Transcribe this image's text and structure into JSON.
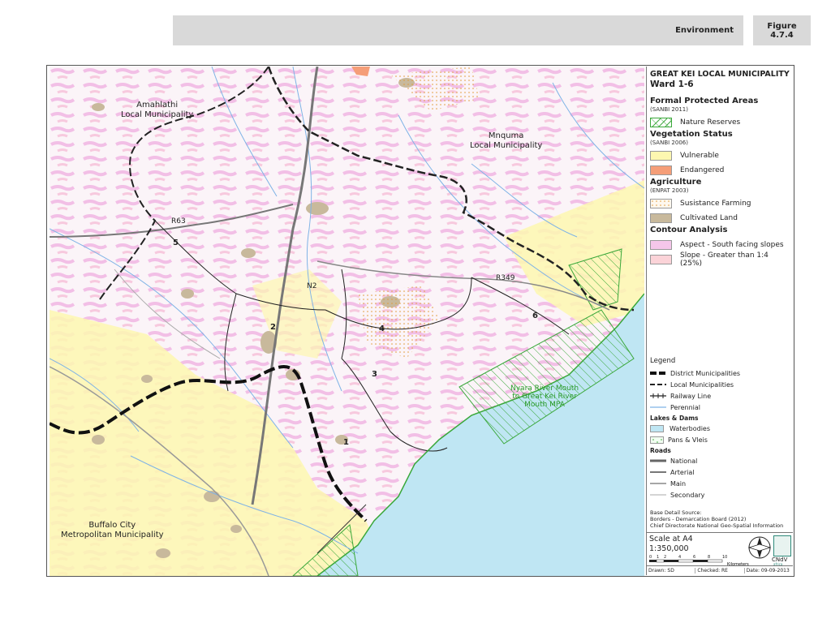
{
  "header": {
    "title": "Environment",
    "figure_label": "Figure",
    "figure_number": "4.7.4"
  },
  "legend": {
    "title": "GREAT KEI LOCAL MUNICIPALITY",
    "subtitle": "Ward 1-6",
    "sections": [
      {
        "title": "Formal Protected Areas",
        "source": "(SANBI 2011)",
        "items": [
          {
            "label": "Nature Reserves",
            "swatch": "hatch-green"
          }
        ]
      },
      {
        "title": "Vegetation Status",
        "source": "(SANBI 2006)",
        "items": [
          {
            "label": "Vulnerable",
            "color": "#fdf7b0"
          },
          {
            "label": "Endangered",
            "color": "#f59e78"
          }
        ]
      },
      {
        "title": "Agriculture",
        "source": "(ENPAT 2003)",
        "items": [
          {
            "label": "Susistance Farming",
            "swatch": "dots-orange"
          },
          {
            "label": "Cultivated Land",
            "color": "#c8b99c"
          }
        ]
      },
      {
        "title": "Contour Analysis",
        "source": "",
        "items": [
          {
            "label": "Aspect - South facing slopes",
            "color": "#f5c6ea"
          },
          {
            "label": "Slope - Greater than 1:4 (25%)",
            "color": "#fbd3d8"
          }
        ]
      }
    ],
    "lines_heading": "Legend",
    "lines": [
      {
        "label": "District Municipalities",
        "style": "district"
      },
      {
        "label": "Local Municipalities",
        "style": "local"
      },
      {
        "label": "Railway Line",
        "style": "rail"
      },
      {
        "label": "Perennial",
        "style": "river"
      }
    ],
    "lakes_heading": "Lakes & Dams",
    "lakes": [
      {
        "label": "Waterbodies",
        "color": "#bfe6f3"
      },
      {
        "label": "Pans & Vleis",
        "swatch": "dots-green"
      }
    ],
    "roads_heading": "Roads",
    "roads": [
      {
        "label": "National",
        "style": "national"
      },
      {
        "label": "Arterial",
        "style": "arterial"
      },
      {
        "label": "Main",
        "style": "main"
      },
      {
        "label": "Secondary",
        "style": "secondary"
      }
    ],
    "base_source": [
      "Base Detail Source:",
      "Borders - Demarcation Board (2012)",
      "Chief Directorate National Geo-Spatial Information"
    ],
    "scale": {
      "label": "Scale at A4",
      "value": "1:350,000",
      "ticks": [
        "0",
        "1",
        "2",
        "4",
        "6",
        "8",
        "10"
      ],
      "unit": "Kilometers"
    },
    "logo_text": "CNdV",
    "logo_sub": "africa",
    "footer": {
      "drawn": "Drawn: SD",
      "checked": "Checked: RE",
      "date": "Date: 09-09-2013"
    }
  },
  "map": {
    "labels": [
      {
        "text": "Amahlathi\nLocal Municipality"
      },
      {
        "text": "Mnquma\nLocal Municipality"
      },
      {
        "text": "Buffalo City\nMetropolitan Municipality"
      }
    ],
    "wards": [
      "1",
      "2",
      "3",
      "4",
      "5",
      "6"
    ],
    "roads": [
      "R63",
      "R349",
      "N2"
    ],
    "mpa_label": "Nyara River Mouth\nto Great Kei River\nMouth MPA"
  },
  "colors": {
    "background": "#ffffff",
    "sea": "#bfe6f3",
    "vulnerable": "#fdf7b0",
    "endangered": "#f59e78",
    "aspect": "#f5c6ea",
    "slope": "#fbd3d8",
    "cultivated": "#c8b99c",
    "nature_reserve": "#3aa83a",
    "river": "#7fb3e6"
  }
}
